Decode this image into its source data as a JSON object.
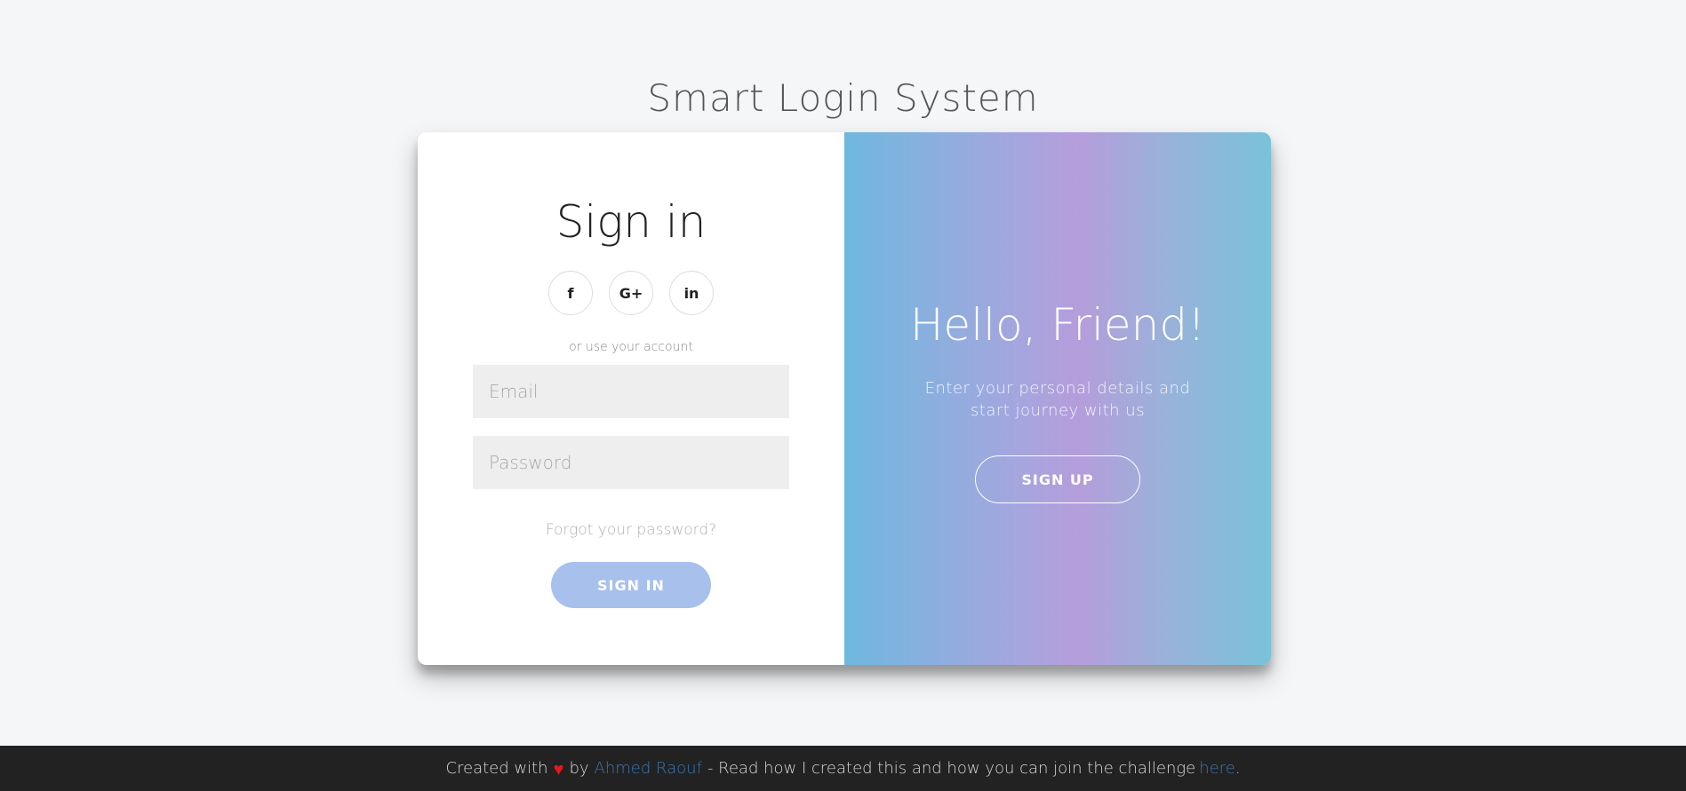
{
  "page": {
    "title": "Smart Login System"
  },
  "signin": {
    "title": "Sign in",
    "social": [
      {
        "label": "f",
        "icon": "facebook-icon"
      },
      {
        "label": "G+",
        "icon": "google-plus-icon"
      },
      {
        "label": "in",
        "icon": "linkedin-icon"
      }
    ],
    "alt_text": "or use your account",
    "email_placeholder": "Email",
    "email_value": "",
    "password_placeholder": "Password",
    "password_value": "",
    "forgot_label": "Forgot your password?",
    "button_label": "SIGN IN"
  },
  "welcome": {
    "title": "Hello, Friend!",
    "text": "Enter your personal details and start journey with us",
    "button_label": "SIGN UP"
  },
  "footer": {
    "prefix": "Created with",
    "heart_icon": "heart-icon",
    "by": "by",
    "author": "Ahmed Raouf",
    "middle": "- Read how I created this and how you can join the challenge",
    "link": "here",
    "suffix": "."
  },
  "colors": {
    "background": "#f5f6f8",
    "signin_button": "#a7c0ec",
    "heart": "#e81616",
    "link": "#3b77b5",
    "footer_bg": "#222222"
  }
}
